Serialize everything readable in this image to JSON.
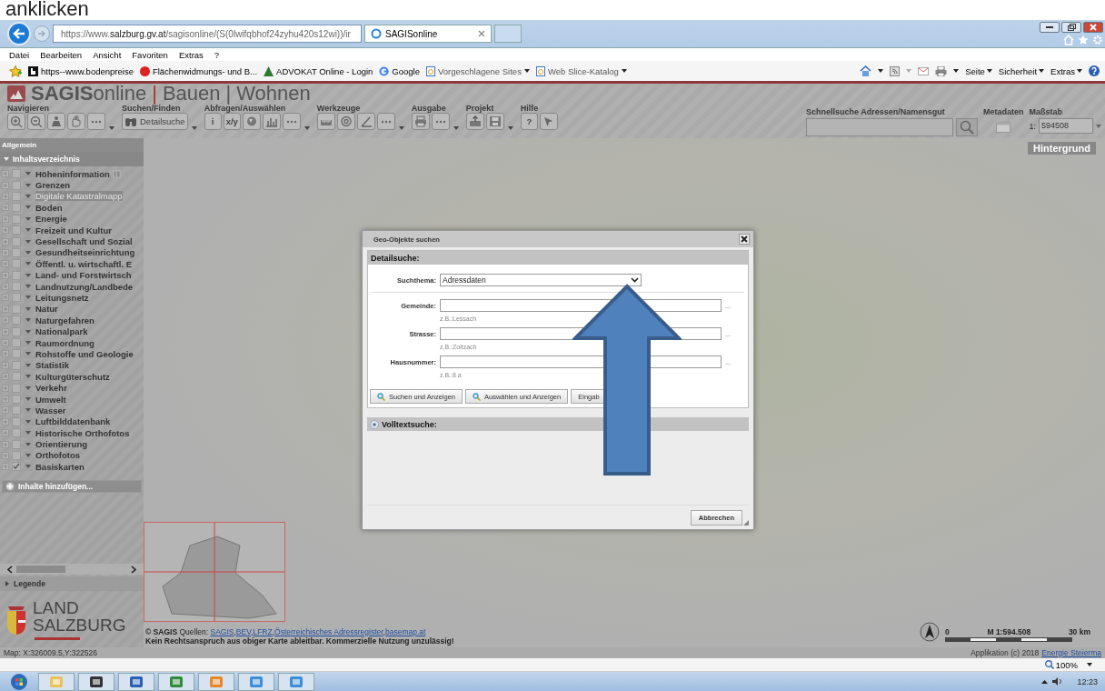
{
  "doc_caption": "anklicken",
  "browser": {
    "address": "https://www.**salzburg.gv.at**/sagisonline/(S(0lwifqbhof24zyhu420s12wi))/ir",
    "tabs": [
      {
        "title": "SAGISonline",
        "selected": true
      }
    ],
    "menu": [
      "Datei",
      "Bearbeiten",
      "Ansicht",
      "Favoriten",
      "Extras",
      "?"
    ],
    "favorites": [
      {
        "label": "https--www.bodenpreise",
        "kind": "b",
        "dropdown": false
      },
      {
        "label": "Flächenwidmungs- und B...",
        "kind": "red",
        "dropdown": false
      },
      {
        "label": "ADVOKAT Online - Login",
        "kind": "tree",
        "dropdown": false
      },
      {
        "label": "Google",
        "kind": "g",
        "dropdown": false
      },
      {
        "label": "Vorgeschlagene Sites",
        "kind": "page",
        "dropdown": true
      },
      {
        "label": "Web Slice-Katalog",
        "kind": "page",
        "dropdown": true
      }
    ],
    "commands": [
      "Seite",
      "Sicherheit",
      "Extras"
    ],
    "zoom": "100%"
  },
  "app": {
    "title": [
      {
        "text": "**SAGIS**online",
        "kind": "name"
      },
      {
        "text": "|",
        "kind": "sep-red"
      },
      {
        "text": "Bauen",
        "kind": "name"
      },
      {
        "text": "|",
        "kind": "sep"
      },
      {
        "text": "Wohnen",
        "kind": "name"
      }
    ],
    "toolbar": [
      {
        "label": "Navigieren",
        "tools": [
          {
            "kind": "zoom-in"
          },
          {
            "kind": "zoom-out"
          },
          {
            "kind": "person"
          },
          {
            "kind": "hand"
          },
          {
            "kind": "dots"
          }
        ],
        "dropdown": true
      },
      {
        "label": "Suchen/Finden",
        "tools": [
          {
            "kind": "binoculars",
            "text": "Detailsuche"
          }
        ],
        "dropdown": true
      },
      {
        "label": "Abfragen/Auswählen",
        "tools": [
          {
            "kind": "text",
            "text": "i"
          },
          {
            "kind": "text",
            "text": "x/y"
          },
          {
            "kind": "globe"
          },
          {
            "kind": "chart"
          },
          {
            "kind": "dots"
          }
        ],
        "dropdown": true
      },
      {
        "label": "Werkzeuge",
        "tools": [
          {
            "kind": "ruler"
          },
          {
            "kind": "at"
          },
          {
            "kind": "pen"
          },
          {
            "kind": "dots"
          }
        ],
        "dropdown": true
      },
      {
        "label": "Ausgabe",
        "tools": [
          {
            "kind": "printer"
          },
          {
            "kind": "dots"
          }
        ],
        "dropdown": true
      },
      {
        "label": "Projekt",
        "tools": [
          {
            "kind": "upload"
          },
          {
            "kind": "disk"
          }
        ],
        "dropdown": true
      },
      {
        "label": "Hilfe",
        "tools": [
          {
            "kind": "text",
            "text": "?"
          },
          {
            "kind": "cursor"
          }
        ],
        "dropdown": false
      }
    ],
    "quicksearch": "Schnellsuche Adressen/Namensgut",
    "metadata": "Metadaten",
    "scale": {
      "label": "Maßstab",
      "prefix": "1:",
      "value": "594508"
    }
  },
  "sidebar": {
    "header": "Allgemein",
    "section": "Inhaltsverzeichnis",
    "layers": [
      {
        "name": "Höheninformation",
        "checked": false,
        "disabled": false,
        "info": true
      },
      {
        "name": "Grenzen",
        "checked": false,
        "disabled": false,
        "info": false
      },
      {
        "name": "Digitale Katastralmapp",
        "checked": false,
        "disabled": true,
        "info": false
      },
      {
        "name": "Boden",
        "checked": false,
        "disabled": false,
        "info": false
      },
      {
        "name": "Energie",
        "checked": false,
        "disabled": false,
        "info": false
      },
      {
        "name": "Freizeit und Kultur",
        "checked": false,
        "disabled": false,
        "info": false
      },
      {
        "name": "Gesellschaft und Sozial",
        "checked": false,
        "disabled": false,
        "info": false
      },
      {
        "name": "Gesundheitseinrichtung",
        "checked": false,
        "disabled": false,
        "info": false
      },
      {
        "name": "Öffentl. u. wirtschaftl. E",
        "checked": false,
        "disabled": false,
        "info": false
      },
      {
        "name": "Land- und Forstwirtsch",
        "checked": false,
        "disabled": false,
        "info": false
      },
      {
        "name": "Landnutzung/Landbede",
        "checked": false,
        "disabled": false,
        "info": false
      },
      {
        "name": "Leitungsnetz",
        "checked": false,
        "disabled": false,
        "info": false
      },
      {
        "name": "Natur",
        "checked": false,
        "disabled": false,
        "info": false
      },
      {
        "name": "Naturgefahren",
        "checked": false,
        "disabled": false,
        "info": false
      },
      {
        "name": "Nationalpark",
        "checked": false,
        "disabled": false,
        "info": false
      },
      {
        "name": "Raumordnung",
        "checked": false,
        "disabled": false,
        "info": false
      },
      {
        "name": "Rohstoffe und Geologie",
        "checked": false,
        "disabled": false,
        "info": false
      },
      {
        "name": "Statistik",
        "checked": false,
        "disabled": false,
        "info": false
      },
      {
        "name": "Kulturgüterschutz",
        "checked": false,
        "disabled": false,
        "info": false
      },
      {
        "name": "Verkehr",
        "checked": false,
        "disabled": false,
        "info": false
      },
      {
        "name": "Umwelt",
        "checked": false,
        "disabled": false,
        "info": false
      },
      {
        "name": "Wasser",
        "checked": false,
        "disabled": false,
        "info": false
      },
      {
        "name": "Luftbilddatenbank",
        "checked": false,
        "disabled": false,
        "info": false
      },
      {
        "name": "Historische Orthofotos",
        "checked": false,
        "disabled": false,
        "info": false
      },
      {
        "name": "Orientierung",
        "checked": false,
        "disabled": false,
        "info": false
      },
      {
        "name": "Orthofotos",
        "checked": false,
        "disabled": false,
        "info": false
      },
      {
        "name": "Basiskarten",
        "checked": true,
        "disabled": false,
        "info": false
      }
    ],
    "add": "Inhalte hinzufügen...",
    "legend": "Legende",
    "logo": [
      "LAND",
      "SALZBURG"
    ]
  },
  "map": {
    "background_label": "Hintergrund",
    "attribution": {
      "owner": "© SAGIS",
      "sources_label": "Quellen:",
      "links": [
        "SAGIS",
        "BEV",
        "LFRZ",
        "Österreichisches Adressregister",
        "basemap.at"
      ],
      "separator": ","
    },
    "disclaimer": "Kein Rechtsanspruch aus obiger Karte ableitbar. Kommerzielle Nutzung unzulässig!",
    "scalebar": {
      "start": "0",
      "ratio": "M 1:594.508",
      "end": "30 km"
    }
  },
  "status": {
    "coords": "Map: X:326009.5,Y:322526",
    "credit": "Applikation (c) 2018",
    "credit_link": "Energie Steierma"
  },
  "dialog": {
    "title": "Geo-Objekte suchen",
    "section": "Detailsuche:",
    "topic": {
      "label": "Suchthema:",
      "value": "Adressdaten"
    },
    "fields": [
      {
        "label": "Gemeinde:",
        "hint": "z.B.:Lessach",
        "more": "..."
      },
      {
        "label": "Strasse:",
        "hint": "z.B.:Zoitzach",
        "more": "..."
      },
      {
        "label": "Hausnummer:",
        "hint": "z.B.:8 a",
        "more": "..."
      }
    ],
    "buttons": [
      {
        "label": "Suchen und Anzeigen",
        "icon": true
      },
      {
        "label": "Auswählen und Anzeigen",
        "icon": true
      },
      {
        "label": "Eingab",
        "icon": false
      }
    ],
    "fulltext": {
      "label": "Volltextsuche:",
      "expanded": false
    },
    "cancel": "Abbrechen"
  },
  "taskbar": {
    "apps": [
      {
        "kind": "folder"
      },
      {
        "kind": "media"
      },
      {
        "kind": "word"
      },
      {
        "kind": "excel"
      },
      {
        "kind": "outlook"
      },
      {
        "kind": "ie"
      },
      {
        "kind": "ie"
      }
    ],
    "time": "12:23"
  }
}
